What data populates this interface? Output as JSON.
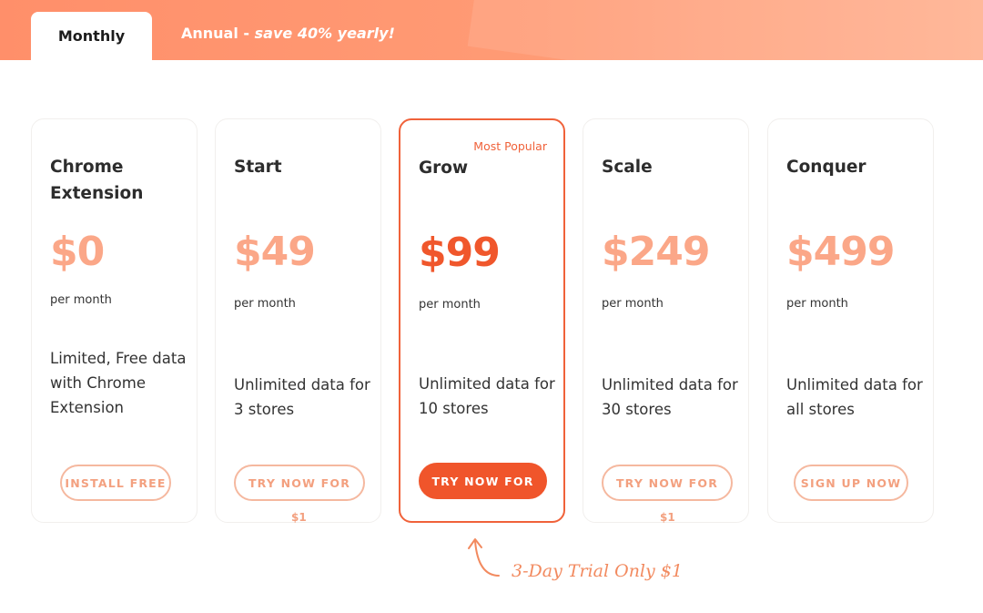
{
  "tabs": {
    "monthly": "Monthly",
    "annual_prefix": "Annual",
    "annual_separator": "-",
    "annual_save": "save 40% yearly!"
  },
  "plans": [
    {
      "name": "Chrome Extension",
      "price": "$0",
      "period": "per month",
      "description": "Limited, Free data with Chrome Extension",
      "button": "INSTALL FREE",
      "button_sub": ""
    },
    {
      "name": "Start",
      "price": "$49",
      "period": "per month",
      "description": "Unlimited data for 3 stores",
      "button": "TRY NOW FOR",
      "button_sub": "$1"
    },
    {
      "name": "Grow",
      "badge": "Most Popular",
      "price": "$99",
      "period": "per month",
      "description": "Unlimited data for 10 stores",
      "button": "TRY NOW FOR",
      "button_sub": ""
    },
    {
      "name": "Scale",
      "price": "$249",
      "period": "per month",
      "description": "Unlimited data for 30 stores",
      "button": "TRY NOW FOR",
      "button_sub": "$1"
    },
    {
      "name": "Conquer",
      "price": "$499",
      "period": "per month",
      "description": "Unlimited data for all stores",
      "button": "SIGN UP NOW",
      "button_sub": ""
    }
  ],
  "trial_note": "3-Day Trial Only $1",
  "colors": {
    "accent": "#f0572c",
    "price_light": "#fba788",
    "header": "#ff9b75"
  }
}
